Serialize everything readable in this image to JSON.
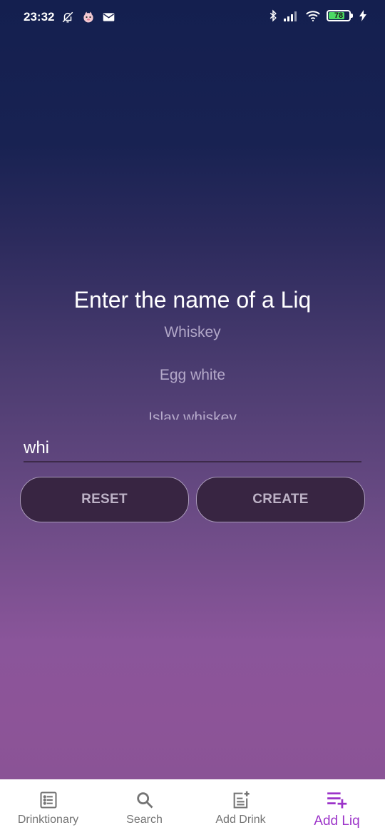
{
  "status_bar": {
    "time": "23:32",
    "battery_level": "78",
    "battery_fraction": 0.78,
    "icons": [
      "alarm-off-icon",
      "app-badge-icon",
      "mail-icon",
      "bluetooth-icon",
      "signal-icon",
      "wifi-icon",
      "battery-icon",
      "charging-icon"
    ]
  },
  "main": {
    "title": "Enter the name of a Liq",
    "suggestions": [
      "Whiskey",
      "Egg white",
      "Islay whiskey"
    ],
    "input_value": "whi",
    "reset_label": "RESET",
    "create_label": "CREATE"
  },
  "nav": {
    "items": [
      {
        "label": "Drinktionary",
        "icon": "list-icon"
      },
      {
        "label": "Search",
        "icon": "search-icon"
      },
      {
        "label": "Add Drink",
        "icon": "note-add-icon"
      },
      {
        "label": "Add Liq",
        "icon": "playlist-add-icon"
      }
    ],
    "active": "Add Liq"
  },
  "colors": {
    "accent": "#9c34c9",
    "button_bg": "#382542",
    "button_text": "#bdb2c6",
    "nav_inactive": "#757575"
  }
}
